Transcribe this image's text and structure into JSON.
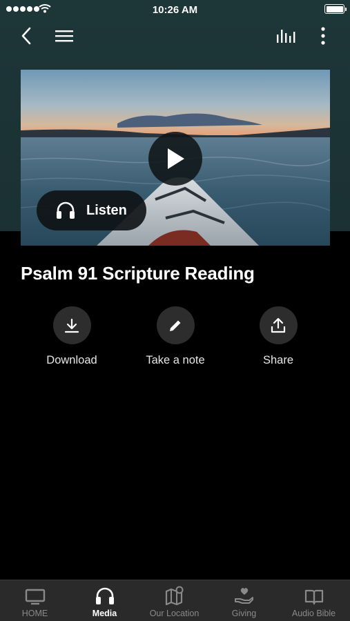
{
  "status_bar": {
    "time": "10:26 AM"
  },
  "nav": {
    "icons": [
      "back-icon",
      "menu-icon",
      "equalizer-icon",
      "more-vert-icon"
    ]
  },
  "hero": {
    "listen_label": "Listen"
  },
  "title": "Psalm 91 Scripture Reading",
  "actions": [
    {
      "label": "Download",
      "icon": "download-icon"
    },
    {
      "label": "Take a note",
      "icon": "pencil-icon"
    },
    {
      "label": "Share",
      "icon": "share-icon"
    }
  ],
  "tabs": [
    {
      "label": "HOME",
      "icon": "tv-icon",
      "active": false
    },
    {
      "label": "Media",
      "icon": "headphones-icon",
      "active": true
    },
    {
      "label": "Our Location",
      "icon": "map-icon",
      "active": false
    },
    {
      "label": "Giving",
      "icon": "giving-hand-icon",
      "active": false
    },
    {
      "label": "Audio Bible",
      "icon": "book-icon",
      "active": false
    }
  ],
  "colors": {
    "header_bg": "#1d3638",
    "tab_bar_bg": "#2a2a2a",
    "action_circle": "#2d2d2d"
  }
}
